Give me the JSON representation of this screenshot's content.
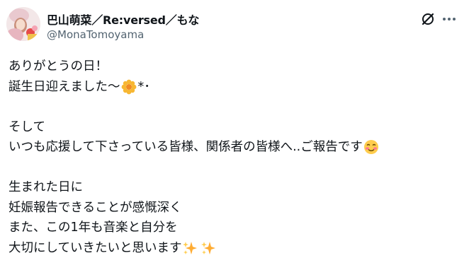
{
  "author": {
    "display_name": "巴山萌菜／Re:versed／もな",
    "handle": "@MonaTomoyama"
  },
  "icons": {
    "avatar": "profile-photo",
    "grok": "grok-icon",
    "more": "more-dots-icon"
  },
  "post": {
    "lines": [
      "ありがとうの日！",
      "誕生日迎えました〜",
      "*･",
      "",
      "そして",
      "いつも応援して下さっている皆様、関係者の皆様へ..ご報告です",
      "",
      "生まれた日に",
      "妊娠報告できることが感慨深く",
      "また、この1年も音楽と自分を",
      "大切にしていきたいと思います"
    ]
  },
  "colors": {
    "text": "#0f1419",
    "secondary": "#536471"
  }
}
